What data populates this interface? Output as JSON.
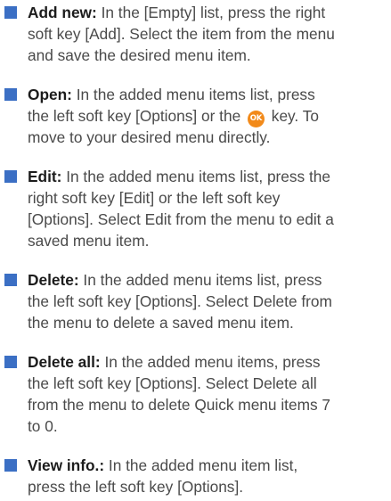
{
  "colors": {
    "bullet": "#3b6fc4",
    "ok_key": "#f28a1a",
    "body_text": "#4a4a4a",
    "term_text": "#1c1c1c"
  },
  "items": [
    {
      "term": "Add new:",
      "lines": [
        " In the [Empty] list, press the right",
        "soft key [Add]. Select the item from the menu",
        "and save the desired menu item."
      ]
    },
    {
      "term": "Open:",
      "line1_before_icon": " In the added menu items list, press",
      "line2_before_icon": "the left soft key [Options] or the",
      "icon": {
        "name": "ok-key-icon",
        "label": "OK"
      },
      "line2_after_icon": " key. To",
      "line3": "move to your desired menu directly."
    },
    {
      "term": "Edit:",
      "lines": [
        " In the added menu items list, press the",
        "right soft key [Edit] or the left soft key",
        "[Options]. Select Edit from the menu to edit a",
        "saved menu item."
      ]
    },
    {
      "term": "Delete:",
      "lines": [
        " In the added menu items list, press",
        "the left soft key [Options]. Select Delete from",
        "the menu to delete a saved menu item."
      ]
    },
    {
      "term": "Delete all:",
      "lines": [
        " In the added menu items, press",
        "the left soft key [Options]. Select Delete all",
        "from the menu to delete Quick menu items 7",
        "to 0."
      ]
    },
    {
      "term": "View info.:",
      "lines": [
        " In the added menu item list,",
        "press the left soft key [Options]."
      ]
    }
  ]
}
